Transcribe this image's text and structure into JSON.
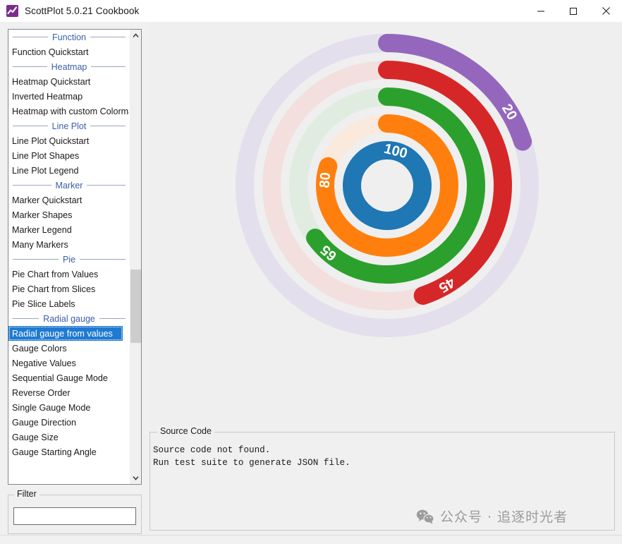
{
  "window": {
    "title": "ScottPlot 5.0.21 Cookbook",
    "icon": "chart-line-icon",
    "controls": {
      "minimize": "minimize-icon",
      "maximize": "maximize-icon",
      "close": "close-icon"
    }
  },
  "sidebar": {
    "scroll": {
      "up_arrow": "chevron-up-icon",
      "down_arrow": "chevron-down-icon"
    },
    "entries": [
      {
        "type": "category",
        "label": "Function"
      },
      {
        "type": "item",
        "label": "Function Quickstart",
        "selected": false
      },
      {
        "type": "category",
        "label": "Heatmap"
      },
      {
        "type": "item",
        "label": "Heatmap Quickstart",
        "selected": false
      },
      {
        "type": "item",
        "label": "Inverted Heatmap",
        "selected": false
      },
      {
        "type": "item",
        "label": "Heatmap with custom Colormap",
        "selected": false
      },
      {
        "type": "category",
        "label": "Line Plot"
      },
      {
        "type": "item",
        "label": "Line Plot Quickstart",
        "selected": false
      },
      {
        "type": "item",
        "label": "Line Plot Shapes",
        "selected": false
      },
      {
        "type": "item",
        "label": "Line Plot Legend",
        "selected": false
      },
      {
        "type": "category",
        "label": "Marker"
      },
      {
        "type": "item",
        "label": "Marker Quickstart",
        "selected": false
      },
      {
        "type": "item",
        "label": "Marker Shapes",
        "selected": false
      },
      {
        "type": "item",
        "label": "Marker Legend",
        "selected": false
      },
      {
        "type": "item",
        "label": "Many Markers",
        "selected": false
      },
      {
        "type": "category",
        "label": "Pie"
      },
      {
        "type": "item",
        "label": "Pie Chart from Values",
        "selected": false
      },
      {
        "type": "item",
        "label": "Pie Chart from Slices",
        "selected": false
      },
      {
        "type": "item",
        "label": "Pie Slice Labels",
        "selected": false
      },
      {
        "type": "category",
        "label": "Radial gauge"
      },
      {
        "type": "item",
        "label": "Radial gauge from values",
        "selected": true
      },
      {
        "type": "item",
        "label": "Gauge Colors",
        "selected": false
      },
      {
        "type": "item",
        "label": "Negative Values",
        "selected": false
      },
      {
        "type": "item",
        "label": "Sequential Gauge Mode",
        "selected": false
      },
      {
        "type": "item",
        "label": "Reverse Order",
        "selected": false
      },
      {
        "type": "item",
        "label": "Single Gauge Mode",
        "selected": false
      },
      {
        "type": "item",
        "label": "Gauge Direction",
        "selected": false
      },
      {
        "type": "item",
        "label": "Gauge Size",
        "selected": false
      },
      {
        "type": "item",
        "label": "Gauge Starting Angle",
        "selected": false
      }
    ]
  },
  "filter": {
    "legend": "Filter",
    "value": "",
    "placeholder": ""
  },
  "source_code": {
    "legend": "Source Code",
    "text": "Source code not found.\nRun test suite to generate JSON file."
  },
  "watermark": {
    "icon": "wechat-icon",
    "text": "公众号 · 追逐时光者"
  },
  "chart_data": {
    "type": "radial_gauge",
    "title": "",
    "background": "#efefef",
    "center": {
      "x": 540,
      "y": 293
    },
    "start_angle_deg": -90,
    "direction": "clockwise",
    "max_value": 100,
    "gauge_width": 26,
    "gauge_gap": 12,
    "inner_hole_radius": 24,
    "series": [
      {
        "index": 0,
        "name": "100",
        "value": 100,
        "color": "#1f77b4",
        "track_color": "#e6eef4",
        "radius": 50,
        "label": "100",
        "label_position": "inside-start"
      },
      {
        "index": 1,
        "name": "80",
        "value": 80,
        "color": "#ff7f0e",
        "track_color": "#faeade",
        "radius": 88,
        "label": "80",
        "label_position": "inside-end"
      },
      {
        "index": 2,
        "name": "65",
        "value": 65,
        "color": "#2ca02c",
        "track_color": "#dfecdf",
        "radius": 126,
        "label": "65",
        "label_position": "inside-end"
      },
      {
        "index": 3,
        "name": "45",
        "value": 45,
        "color": "#d62728",
        "track_color": "#f4dfdf",
        "radius": 164,
        "label": "45",
        "label_position": "inside-end"
      },
      {
        "index": 4,
        "name": "20",
        "value": 20,
        "color": "#9467bd",
        "track_color": "#e4dfec",
        "radius": 202,
        "label": "20",
        "label_position": "inside-end"
      }
    ],
    "values": [
      100,
      80,
      65,
      45,
      20
    ],
    "categories": [
      "100",
      "80",
      "65",
      "45",
      "20"
    ],
    "legend": null,
    "grid": false
  }
}
